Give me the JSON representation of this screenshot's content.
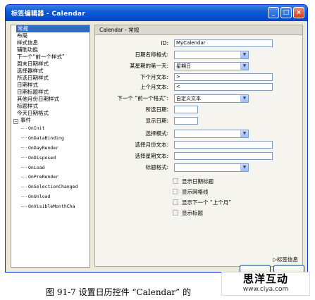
{
  "window": {
    "title": "标签编辑器 - Calendar",
    "minimize": "_",
    "maximize": "□",
    "close": "×"
  },
  "tree": {
    "items": [
      "常规",
      "布局",
      "样式信息",
      "辅助功能",
      "下一个“前一个样式”",
      "周末日期样式",
      "选择器样式",
      "所选日期样式",
      "日期样式",
      "日期标题样式",
      "其他月份日期样式",
      "标题样式",
      "今天日期格式"
    ],
    "events_label": "事件",
    "events": [
      "OnInit",
      "OnDataBinding",
      "OnDayRender",
      "OnDisposed",
      "OnLoad",
      "OnPreRender",
      "OnSelectionChanged",
      "OnUnload",
      "OnVisibleMonthCha"
    ]
  },
  "panel": {
    "header": "Calendar - 常规",
    "id_label": "ID:",
    "id_value": "MyCalendar",
    "day_name_format_label": "日期名称格式:",
    "first_day_label": "某星期的第一天:",
    "first_day_value": "星期日",
    "next_month_text_label": "下个月文本:",
    "next_month_text_value": ">",
    "prev_month_text_label": "上个月文本:",
    "prev_month_text_value": "<",
    "next_prev_format_label": "下一个 “前一个格式”:",
    "next_prev_format_value": "自定义文本",
    "selected_date_label": "所选日期:",
    "visible_date_label": "显示日期:",
    "selection_mode_label": "选择模式:",
    "select_month_text_label": "选择月份文本:",
    "select_week_text_label": "选择星期文本:",
    "title_format_label": "标题格式:",
    "cb_day_header": "显示日期标题",
    "cb_grid": "显示网格线",
    "cb_next_prev": "显示下一个 “上个月”",
    "cb_title": "显示标题",
    "tag_info": "▷标签信息"
  },
  "caption": "图 91-7   设置日历控件 “Calendar” 的",
  "watermark": {
    "chinese": "思洋互动",
    "url": "www.ciya.com"
  }
}
